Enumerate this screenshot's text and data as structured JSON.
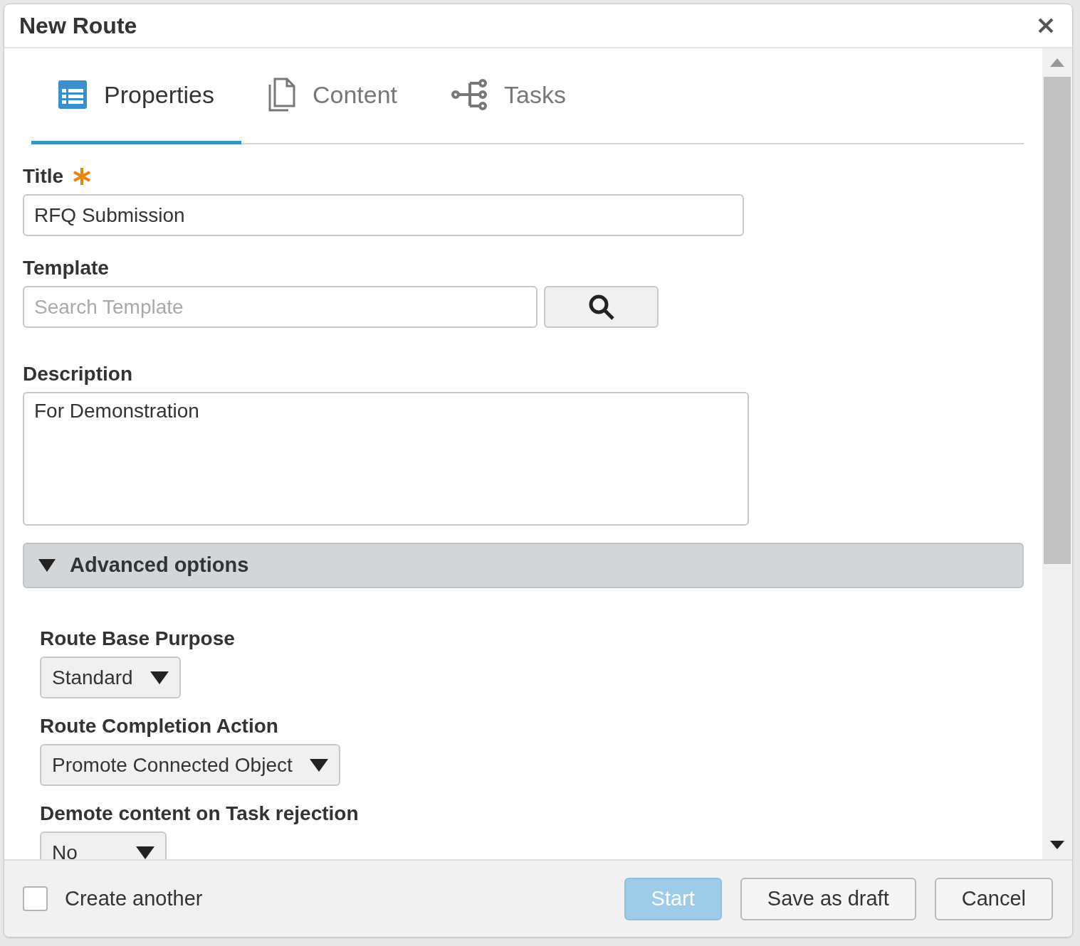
{
  "dialog": {
    "title": "New Route"
  },
  "tabs": [
    {
      "label": "Properties",
      "selected": true,
      "kind": "properties"
    },
    {
      "label": "Content",
      "selected": false,
      "kind": "content"
    },
    {
      "label": "Tasks",
      "selected": false,
      "kind": "tasks"
    }
  ],
  "fields": [
    {
      "kind": "text",
      "label": "Title",
      "required": true,
      "value": "RFQ Submission"
    },
    {
      "kind": "search",
      "label": "Template",
      "required": false,
      "placeholder": "Search Template"
    },
    {
      "kind": "textarea",
      "label": "Description",
      "required": false,
      "value": "For Demonstration"
    }
  ],
  "advanced": {
    "label": "Advanced options",
    "expanded": true,
    "selects": [
      {
        "label": "Route Base Purpose",
        "value": "Standard"
      },
      {
        "label": "Route Completion Action",
        "value": "Promote Connected Object"
      },
      {
        "label": "Demote content on Task rejection",
        "value": "No"
      }
    ]
  },
  "footer": {
    "create_another": {
      "label": "Create another",
      "checked": false
    },
    "buttons": [
      {
        "label": "Start",
        "kind": "primary",
        "disabled": true
      },
      {
        "label": "Save as draft",
        "kind": "default",
        "disabled": false
      },
      {
        "label": "Cancel",
        "kind": "default",
        "disabled": false
      }
    ]
  }
}
